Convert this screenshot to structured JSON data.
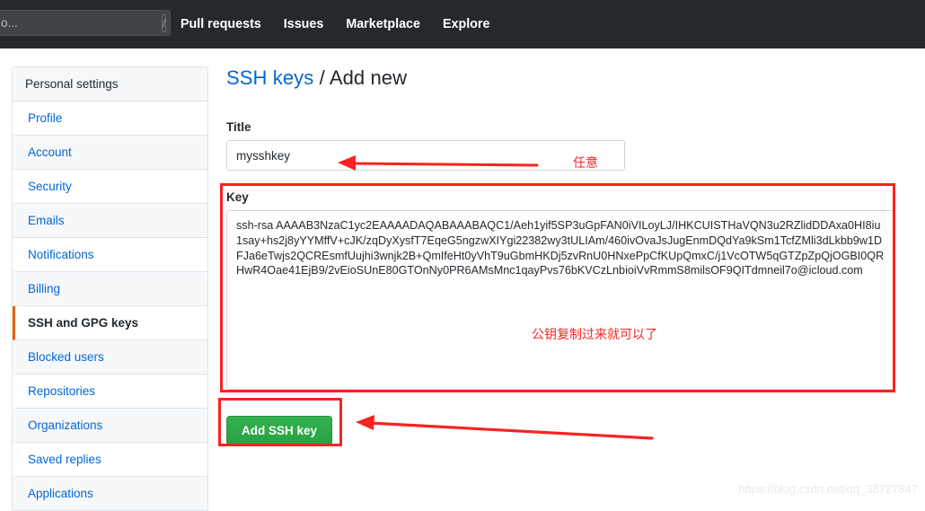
{
  "topnav": {
    "search_value": "o...",
    "search_placeholder": "Search or jump to...",
    "slash_badge": "/",
    "links": [
      {
        "label": "Pull requests"
      },
      {
        "label": "Issues"
      },
      {
        "label": "Marketplace"
      },
      {
        "label": "Explore"
      }
    ]
  },
  "sidebar": {
    "heading": "Personal settings",
    "items": [
      {
        "label": "Profile",
        "active": false
      },
      {
        "label": "Account",
        "active": false
      },
      {
        "label": "Security",
        "active": false
      },
      {
        "label": "Emails",
        "active": false
      },
      {
        "label": "Notifications",
        "active": false
      },
      {
        "label": "Billing",
        "active": false
      },
      {
        "label": "SSH and GPG keys",
        "active": true
      },
      {
        "label": "Blocked users",
        "active": false
      },
      {
        "label": "Repositories",
        "active": false
      },
      {
        "label": "Organizations",
        "active": false
      },
      {
        "label": "Saved replies",
        "active": false
      },
      {
        "label": "Applications",
        "active": false
      }
    ]
  },
  "main": {
    "title_link": "SSH keys",
    "title_rest": " / Add new",
    "title_field": {
      "label": "Title",
      "value": "mysshkey",
      "placeholder": ""
    },
    "key_field": {
      "label": "Key",
      "value": "ssh-rsa AAAAB3NzaC1yc2EAAAADAQABAAABAQC1/Aeh1yif5SP3uGpFAN0iVILoyLJ/IHKCUISTHaVQN3u2RZlidDDAxa0HI8iu1say+hs2j8yYYMffV+cJK/zqDyXysfT7EqeG5ngzwXIYgi22382wy3tULIAm/460ivOvaJsJugEnmDQdYa9kSm1TcfZMli3dLkbb9w1DFJa6eTwjs2QCREsmfUujhi3wnjk2B+QmIfeHt0yVhT9uGbmHKDj5zvRnU0HNxePpCfKUpQmxC/j1VcOTW5qGTZpZpQjOGBI0QRHwR4Oae41EjB9/2vEioSUnE80GTOnNy0PR6AMsMnc1qayPvs76bKVCzLnbioiVvRmmS8milsOF9QITdmneil7o@icloud.com",
      "placeholder": ""
    },
    "submit_label": "Add SSH key"
  },
  "annotations": {
    "title_note": "任意",
    "key_note": "公钥复制过来就可以了"
  },
  "watermark": "https://blog.csdn.net/qq_38727847",
  "colors": {
    "nav_bg": "#24292e",
    "link_blue": "#0366d6",
    "active_orange": "#e36209",
    "button_green": "#2aa144",
    "annotation_red": "#fb2222"
  }
}
